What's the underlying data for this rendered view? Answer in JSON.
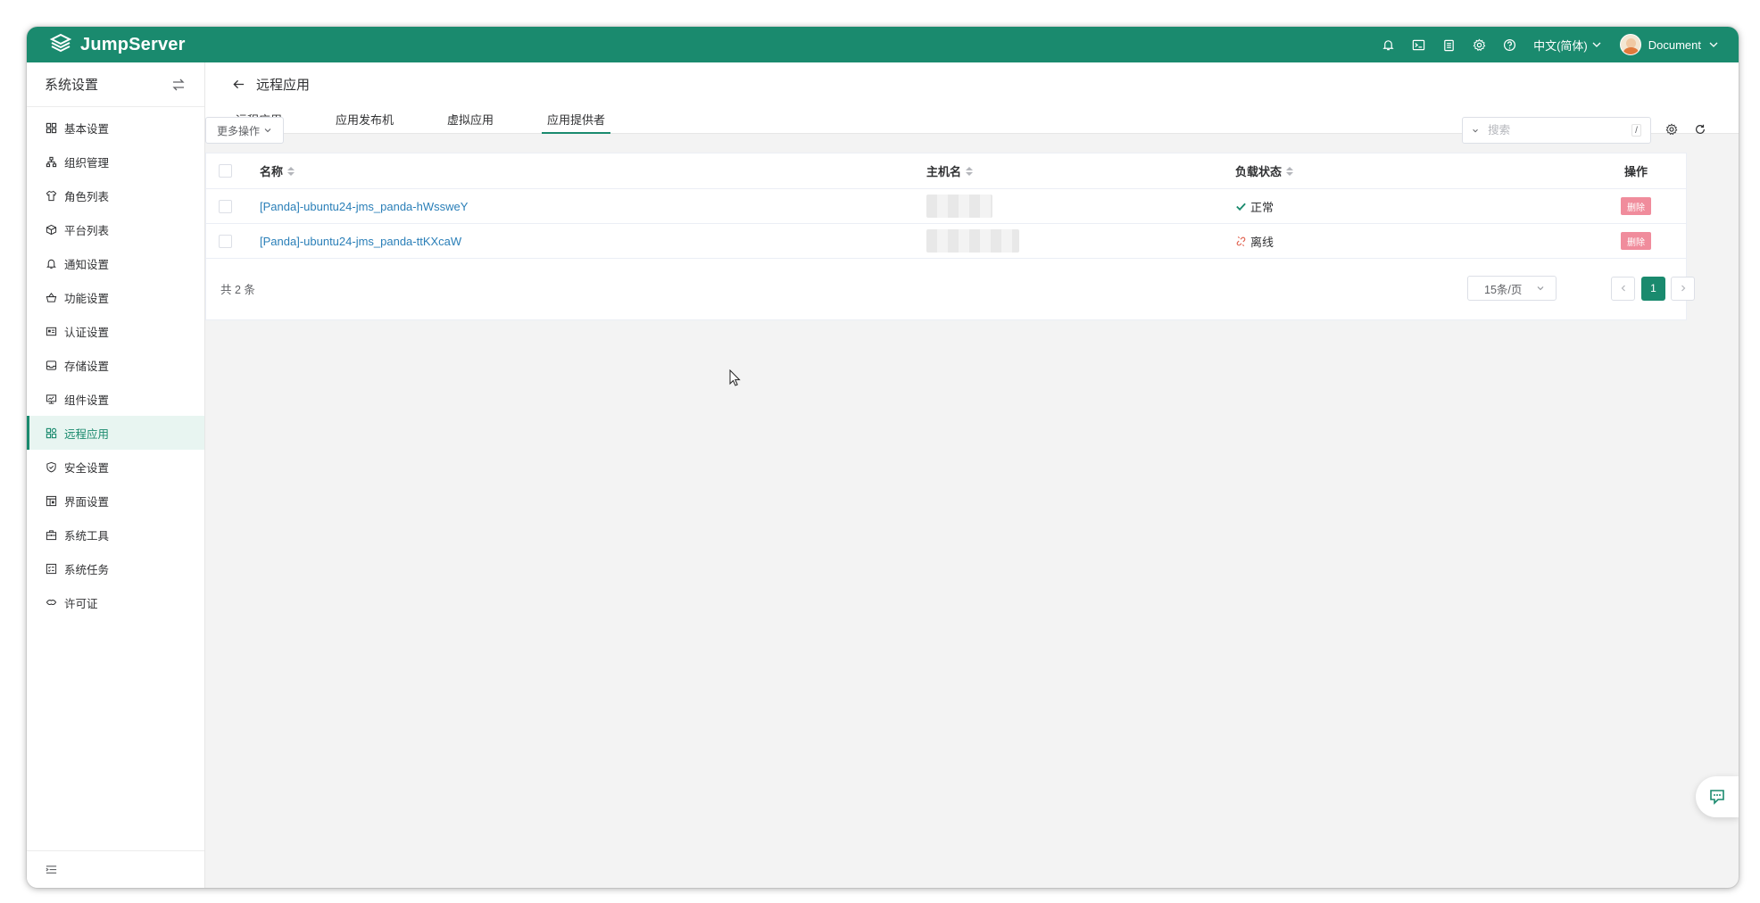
{
  "app": {
    "brand": "JumpServer"
  },
  "topbar": {
    "icons": [
      "bell-icon",
      "terminal-icon",
      "clipboard-icon",
      "gear-icon",
      "help-icon"
    ],
    "language": "中文(简体)",
    "user": "Document"
  },
  "sidebar": {
    "title": "系统设置",
    "items": [
      {
        "label": "基本设置",
        "icon": "grid-icon"
      },
      {
        "label": "组织管理",
        "icon": "org-icon"
      },
      {
        "label": "角色列表",
        "icon": "shirt-icon"
      },
      {
        "label": "平台列表",
        "icon": "cube-icon"
      },
      {
        "label": "通知设置",
        "icon": "bell-icon"
      },
      {
        "label": "功能设置",
        "icon": "basket-icon"
      },
      {
        "label": "认证设置",
        "icon": "id-card-icon"
      },
      {
        "label": "存储设置",
        "icon": "inbox-icon"
      },
      {
        "label": "组件设置",
        "icon": "monitor-icon"
      },
      {
        "label": "远程应用",
        "icon": "apps-icon",
        "active": true
      },
      {
        "label": "安全设置",
        "icon": "shield-icon"
      },
      {
        "label": "界面设置",
        "icon": "layout-icon"
      },
      {
        "label": "系统工具",
        "icon": "toolbox-icon"
      },
      {
        "label": "系统任务",
        "icon": "task-icon"
      },
      {
        "label": "许可证",
        "icon": "license-icon"
      }
    ]
  },
  "page": {
    "title": "远程应用",
    "tabs": [
      {
        "label": "远程应用"
      },
      {
        "label": "应用发布机"
      },
      {
        "label": "虚拟应用"
      },
      {
        "label": "应用提供者",
        "active": true
      }
    ]
  },
  "toolbar": {
    "more_actions": "更多操作",
    "search_placeholder": "搜索",
    "search_shortcut": "/"
  },
  "table": {
    "columns": {
      "name": "名称",
      "host": "主机名",
      "status": "负载状态",
      "action": "操作"
    },
    "rows": [
      {
        "name": "[Panda]-ubuntu24-jms_panda-hWssweY",
        "status": "正常",
        "status_kind": "ok",
        "action": "删除"
      },
      {
        "name": "[Panda]-ubuntu24-jms_panda-ttKXcaW",
        "status": "离线",
        "status_kind": "offline",
        "action": "删除"
      }
    ],
    "total": "共 2 条",
    "page_size": "15条/页",
    "current_page": "1"
  },
  "colors": {
    "brand": "#1a8a6e",
    "link": "#2a7fb8",
    "danger": "#f08c9c"
  }
}
